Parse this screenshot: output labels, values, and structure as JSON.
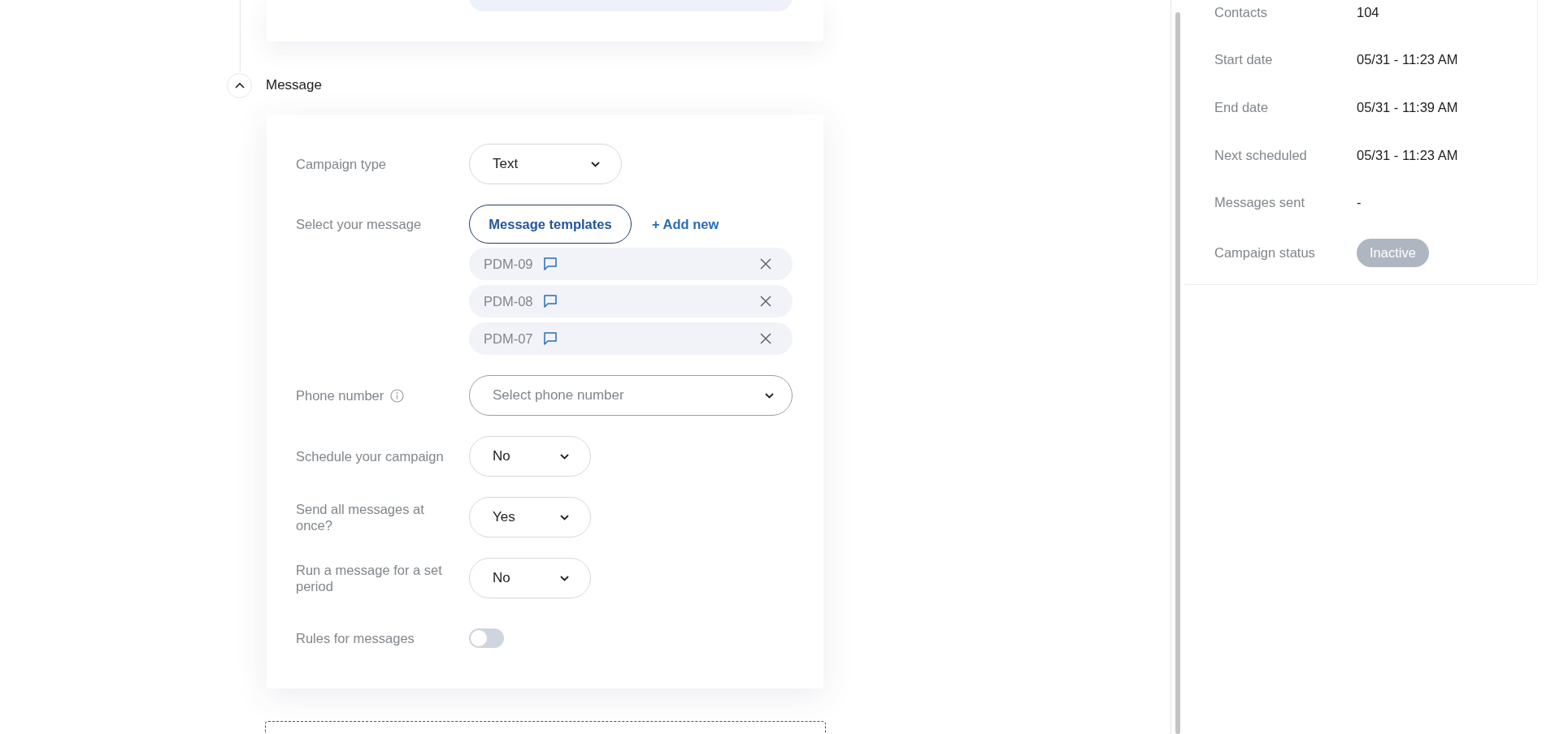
{
  "message_section": {
    "title": "Message",
    "expanded": true,
    "fields": [
      {
        "kind": "select",
        "label": "Campaign type",
        "value": "Text"
      },
      {
        "kind": "messages",
        "label": "Select your message",
        "button": "Message templates",
        "link": "+ Add new",
        "items": [
          {
            "name": "PDM-09"
          },
          {
            "name": "PDM-08"
          },
          {
            "name": "PDM-07"
          }
        ]
      },
      {
        "kind": "phone",
        "label": "Phone number",
        "info": true,
        "placeholder": "Select phone number"
      },
      {
        "kind": "select",
        "label": "Schedule your campaign",
        "value": "No"
      },
      {
        "kind": "select",
        "label": "Send all messages at once?",
        "value": "Yes"
      },
      {
        "kind": "select",
        "label": "Run a message for a set period",
        "value": "No"
      },
      {
        "kind": "toggle",
        "label": "Rules for messages",
        "on": false
      }
    ]
  },
  "summary": {
    "rows": [
      {
        "kind": "text",
        "label": "Contacts",
        "value": "104"
      },
      {
        "kind": "text",
        "label": "Start date",
        "value": "05/31 - 11:23 AM"
      },
      {
        "kind": "text",
        "label": "End date",
        "value": "05/31 - 11:39 AM"
      },
      {
        "kind": "text",
        "label": "Next scheduled",
        "value": "05/31 - 11:23 AM"
      },
      {
        "kind": "text",
        "label": "Messages sent",
        "value": "-"
      },
      {
        "kind": "status",
        "label": "Campaign status",
        "value": "Inactive"
      }
    ]
  }
}
